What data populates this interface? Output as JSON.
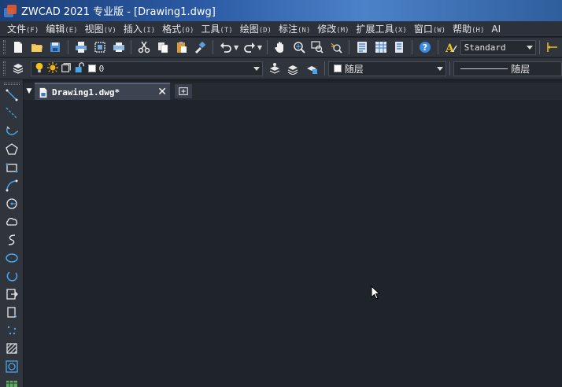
{
  "window": {
    "title": "ZWCAD 2021 专业版 - [Drawing1.dwg]"
  },
  "menu": [
    {
      "label": "文件",
      "hotkey": "(F)"
    },
    {
      "label": "编辑",
      "hotkey": "(E)"
    },
    {
      "label": "视图",
      "hotkey": "(V)"
    },
    {
      "label": "插入",
      "hotkey": "(I)"
    },
    {
      "label": "格式",
      "hotkey": "(O)"
    },
    {
      "label": "工具",
      "hotkey": "(T)"
    },
    {
      "label": "绘图",
      "hotkey": "(D)"
    },
    {
      "label": "标注",
      "hotkey": "(N)"
    },
    {
      "label": "修改",
      "hotkey": "(M)"
    },
    {
      "label": "扩展工具",
      "hotkey": "(X)"
    },
    {
      "label": "窗口",
      "hotkey": "(W)"
    },
    {
      "label": "帮助",
      "hotkey": "(H)"
    },
    {
      "label": "AI",
      "hotkey": ""
    }
  ],
  "toolbar": {
    "text_style": "Standard"
  },
  "layers": {
    "current_layer": "0",
    "color": "随层",
    "linetype": "随层"
  },
  "tabs": {
    "document_title": "Drawing1.dwg*"
  },
  "colors": {
    "canvas": "#1f232a",
    "titlebar": "#2a5aa3",
    "accent_icon": "#4aa3e8",
    "bulb": "#f2c21b"
  }
}
